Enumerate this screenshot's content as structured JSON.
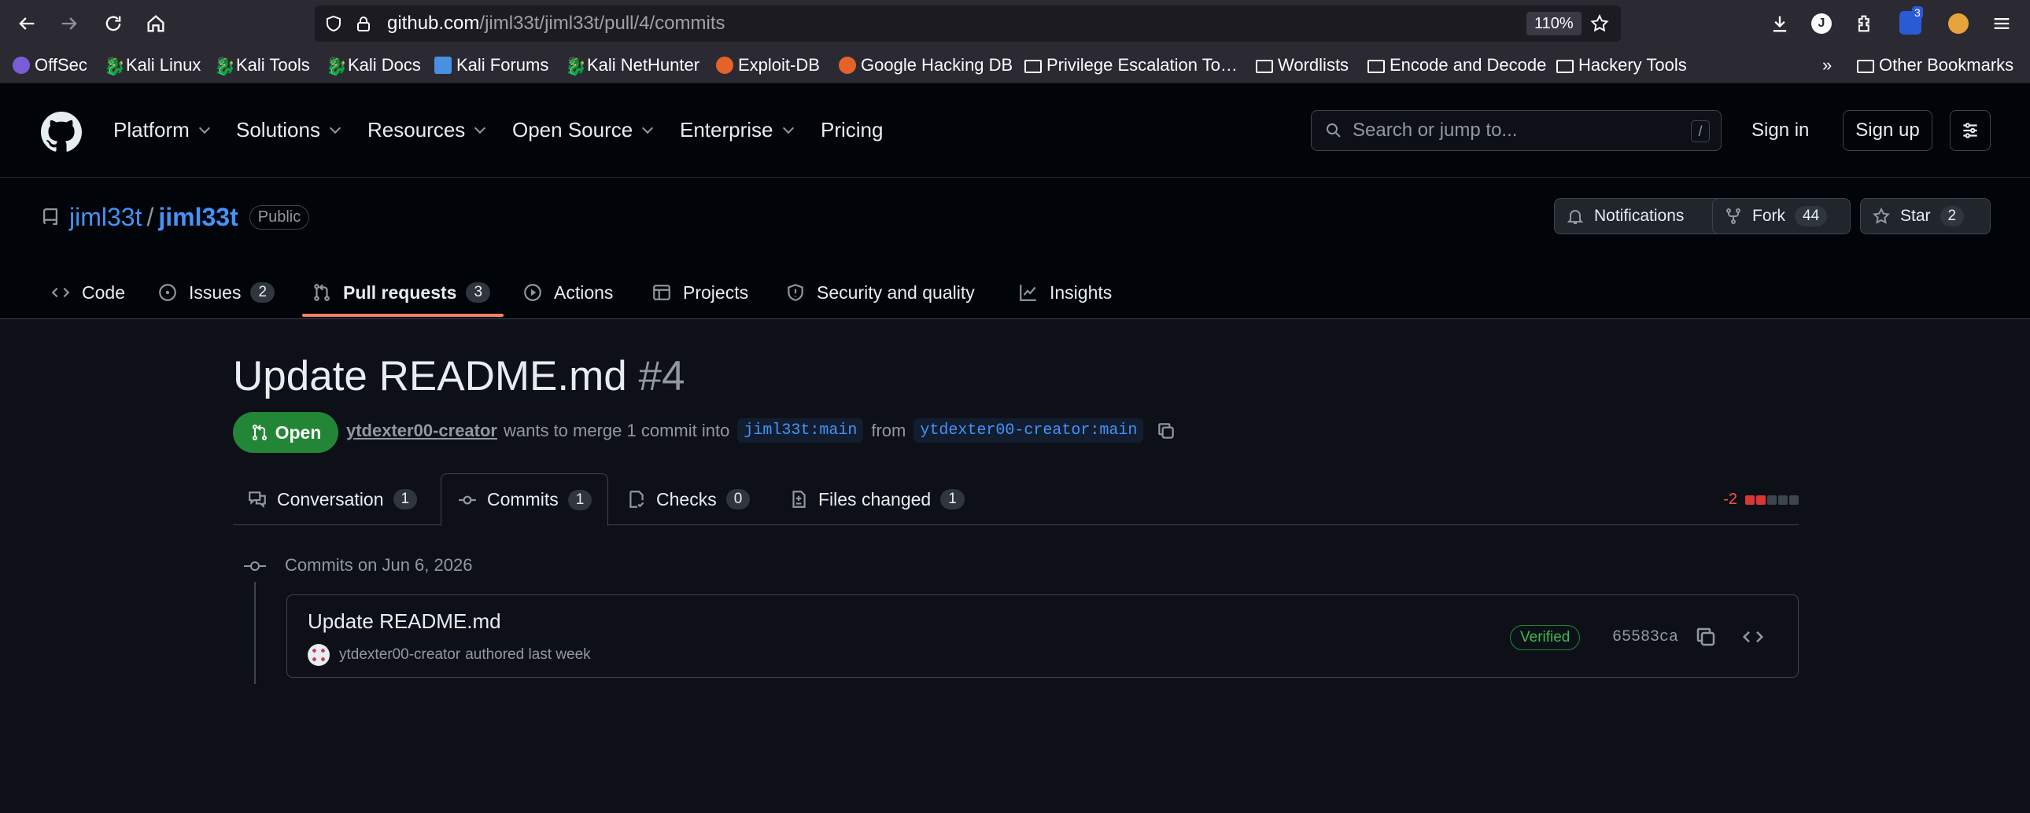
{
  "browser": {
    "url_host": "github.com",
    "url_path": "/jiml33t/jiml33t/pull/4/commits",
    "zoom": "110%",
    "extension_badge": "3",
    "bookmarks": [
      "OffSec",
      "Kali Linux",
      "Kali Tools",
      "Kali Docs",
      "Kali Forums",
      "Kali NetHunter",
      "Exploit-DB",
      "Google Hacking DB",
      "Privilege Escalation To…",
      "Wordlists",
      "Encode and Decode",
      "Hackery Tools"
    ],
    "other_bookmarks": "Other Bookmarks"
  },
  "header": {
    "nav": [
      "Platform",
      "Solutions",
      "Resources",
      "Open Source",
      "Enterprise",
      "Pricing"
    ],
    "search_placeholder": "Search or jump to...",
    "search_key": "/",
    "sign_in": "Sign in",
    "sign_up": "Sign up"
  },
  "repo": {
    "owner": "jiml33t",
    "separator": "/",
    "name": "jiml33t",
    "visibility": "Public",
    "notifications": "Notifications",
    "fork_label": "Fork",
    "fork_count": "44",
    "star_label": "Star",
    "star_count": "2",
    "tabs": [
      {
        "label": "Code",
        "count": ""
      },
      {
        "label": "Issues",
        "count": "2"
      },
      {
        "label": "Pull requests",
        "count": "3"
      },
      {
        "label": "Actions",
        "count": ""
      },
      {
        "label": "Projects",
        "count": ""
      },
      {
        "label": "Security and quality",
        "count": ""
      },
      {
        "label": "Insights",
        "count": ""
      }
    ]
  },
  "pr": {
    "title": "Update README.md",
    "number": "#4",
    "state": "Open",
    "author": "ytdexter00-creator",
    "merge_text": "wants to merge 1 commit into",
    "base_branch": "jiml33t:main",
    "from_text": "from",
    "head_branch": "ytdexter00-creator:main",
    "tabs": [
      {
        "label": "Conversation",
        "count": "1"
      },
      {
        "label": "Commits",
        "count": "1"
      },
      {
        "label": "Checks",
        "count": "0"
      },
      {
        "label": "Files changed",
        "count": "1"
      }
    ],
    "diffstat": "-2"
  },
  "commits": {
    "date_heading": "Commits on Jun 6, 2026",
    "items": [
      {
        "message": "Update README.md",
        "author": "ytdexter00-creator",
        "authored": "authored last week",
        "verified": "Verified",
        "sha": "65583ca"
      }
    ]
  }
}
